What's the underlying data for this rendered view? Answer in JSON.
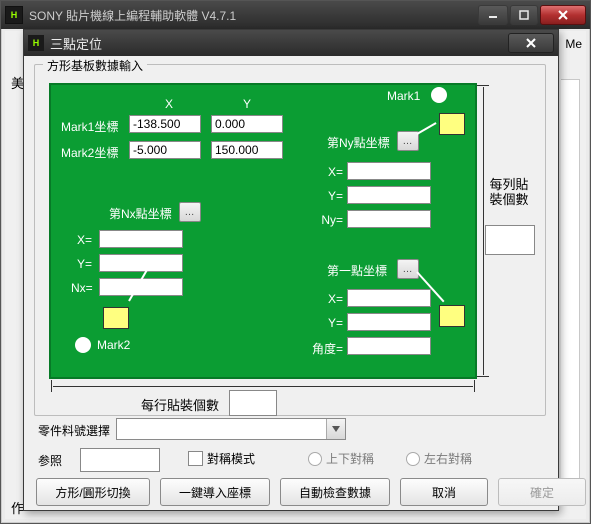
{
  "outer": {
    "title": "SONY 貼片機線上編程輔助軟體  V4.7.1",
    "frag_me": "Me",
    "frag_left": "美",
    "frag_bottom": "作"
  },
  "dialog": {
    "title": "三點定位"
  },
  "fieldset": {
    "legend": "方形基板數據輸入"
  },
  "board": {
    "col_x": "X",
    "col_y": "Y",
    "mark1_row": "Mark1坐標",
    "mark2_row": "Mark2坐標",
    "mark1_x": "-138.500",
    "mark1_y": "0.000",
    "mark2_x": "-5.000",
    "mark2_y": "150.000",
    "mark1_label": "Mark1",
    "mark2_label": "Mark2",
    "nx_title": "第Nx點坐標",
    "ny_title": "第Ny點坐標",
    "first_title": "第一點坐標",
    "x_eq": "X=",
    "y_eq": "Y=",
    "nx_eq": "Nx=",
    "ny_eq": "Ny=",
    "angle_eq": "角度="
  },
  "side": {
    "per_col": "每列貼裝個數",
    "per_row": "每行貼裝個數"
  },
  "lower": {
    "part_label": "零件料號選擇",
    "ref_label": "参照",
    "mirror_mode": "對稱模式",
    "vert_mirror": "上下對稱",
    "horiz_mirror": "左右對稱"
  },
  "buttons": {
    "shape_toggle": "方形/圓形切換",
    "import": "一鍵導入座標",
    "autocheck": "自動檢查數據",
    "cancel": "取消",
    "ok": "確定"
  }
}
